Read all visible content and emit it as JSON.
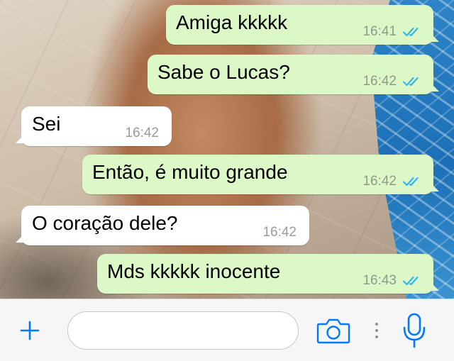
{
  "chat": {
    "messages": [
      {
        "text": "Amiga kkkkk",
        "time": "16:41",
        "direction": "outgoing",
        "status": "read"
      },
      {
        "text": "Sabe o Lucas?",
        "time": "16:42",
        "direction": "outgoing",
        "status": "read"
      },
      {
        "text": "Sei",
        "time": "16:42",
        "direction": "incoming"
      },
      {
        "text": "Então, é muito grande",
        "time": "16:42",
        "direction": "outgoing",
        "status": "read"
      },
      {
        "text": "O coração dele?",
        "time": "16:42",
        "direction": "incoming"
      },
      {
        "text": "Mds kkkkk inocente",
        "time": "16:43",
        "direction": "outgoing",
        "status": "read"
      }
    ]
  },
  "input_bar": {
    "message_placeholder": "",
    "message_value": "",
    "icons": {
      "attach": "plus-icon",
      "camera": "camera-icon",
      "more": "vertical-dots-icon",
      "voice": "microphone-icon"
    }
  },
  "colors": {
    "outgoing_bubble": "#dcf8c6",
    "incoming_bubble": "#ffffff",
    "read_ticks": "#34b7f1",
    "accent_icons": "#007aff",
    "input_bar_bg": "#f6f6f6"
  }
}
